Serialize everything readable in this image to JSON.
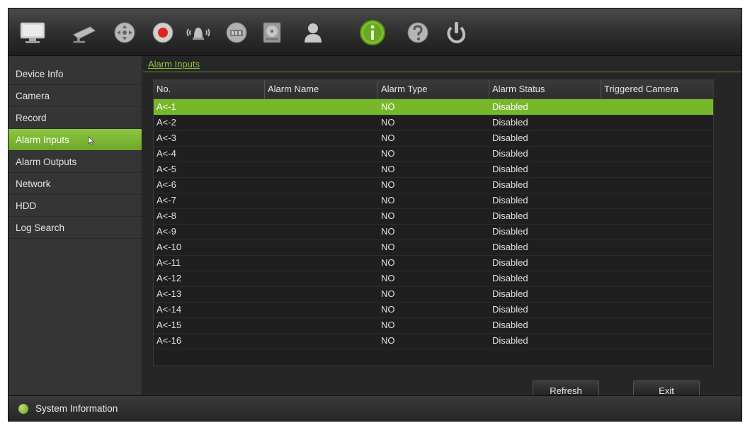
{
  "toolbar": {
    "icons": [
      "monitor-icon",
      "camera-icon",
      "ptz-icon",
      "record-icon",
      "alarm-icon",
      "network-icon",
      "hdd-icon",
      "user-icon",
      "info-icon",
      "help-icon",
      "power-icon"
    ],
    "active_icon": "info-icon"
  },
  "sidebar": {
    "items": [
      {
        "label": "Device Info"
      },
      {
        "label": "Camera"
      },
      {
        "label": "Record"
      },
      {
        "label": "Alarm Inputs",
        "active": true
      },
      {
        "label": "Alarm Outputs"
      },
      {
        "label": "Network"
      },
      {
        "label": "HDD"
      },
      {
        "label": "Log Search"
      }
    ]
  },
  "main": {
    "breadcrumb": "Alarm Inputs",
    "table": {
      "columns": [
        "No.",
        "Alarm Name",
        "Alarm Type",
        "Alarm Status",
        "Triggered Camera"
      ],
      "rows": [
        {
          "no": "A<-1",
          "name": "",
          "type": "NO",
          "status": "Disabled",
          "camera": "",
          "selected": true
        },
        {
          "no": "A<-2",
          "name": "",
          "type": "NO",
          "status": "Disabled",
          "camera": ""
        },
        {
          "no": "A<-3",
          "name": "",
          "type": "NO",
          "status": "Disabled",
          "camera": ""
        },
        {
          "no": "A<-4",
          "name": "",
          "type": "NO",
          "status": "Disabled",
          "camera": ""
        },
        {
          "no": "A<-5",
          "name": "",
          "type": "NO",
          "status": "Disabled",
          "camera": ""
        },
        {
          "no": "A<-6",
          "name": "",
          "type": "NO",
          "status": "Disabled",
          "camera": ""
        },
        {
          "no": "A<-7",
          "name": "",
          "type": "NO",
          "status": "Disabled",
          "camera": ""
        },
        {
          "no": "A<-8",
          "name": "",
          "type": "NO",
          "status": "Disabled",
          "camera": ""
        },
        {
          "no": "A<-9",
          "name": "",
          "type": "NO",
          "status": "Disabled",
          "camera": ""
        },
        {
          "no": "A<-10",
          "name": "",
          "type": "NO",
          "status": "Disabled",
          "camera": ""
        },
        {
          "no": "A<-11",
          "name": "",
          "type": "NO",
          "status": "Disabled",
          "camera": ""
        },
        {
          "no": "A<-12",
          "name": "",
          "type": "NO",
          "status": "Disabled",
          "camera": ""
        },
        {
          "no": "A<-13",
          "name": "",
          "type": "NO",
          "status": "Disabled",
          "camera": ""
        },
        {
          "no": "A<-14",
          "name": "",
          "type": "NO",
          "status": "Disabled",
          "camera": ""
        },
        {
          "no": "A<-15",
          "name": "",
          "type": "NO",
          "status": "Disabled",
          "camera": ""
        },
        {
          "no": "A<-16",
          "name": "",
          "type": "NO",
          "status": "Disabled",
          "camera": ""
        }
      ]
    },
    "buttons": {
      "refresh": "Refresh",
      "exit": "Exit"
    }
  },
  "statusbar": {
    "text": "System Information",
    "icon": "info-icon"
  },
  "colors": {
    "accent": "#8cc63f",
    "selected_row": "#76b82a",
    "background": "#262626"
  }
}
